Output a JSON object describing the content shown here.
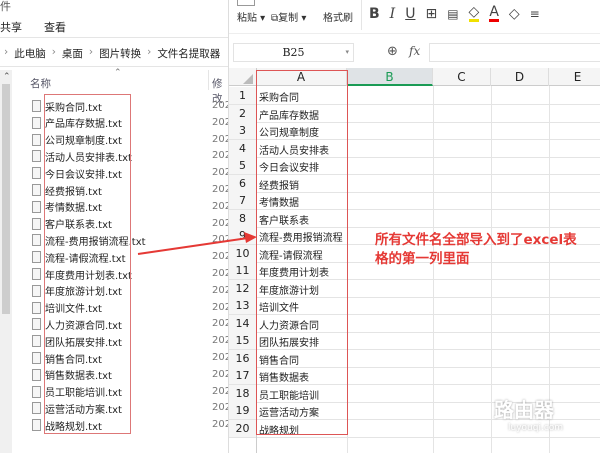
{
  "explorer": {
    "title_char": "件",
    "ribbon": [
      "共享",
      "查看"
    ],
    "breadcrumb": [
      "此电脑",
      "桌面",
      "图片转换",
      "文件名提取器"
    ],
    "col_name": "名称",
    "col_date": "修改",
    "date_prefix": "202",
    "files": [
      "采购合同.txt",
      "产品库存数据.txt",
      "公司规章制度.txt",
      "活动人员安排表.txt",
      "今日会议安排.txt",
      "经费报销.txt",
      "考情数据.txt",
      "客户联系表.txt",
      "流程-费用报销流程.txt",
      "流程-请假流程.txt",
      "年度费用计划表.txt",
      "年度旅游计划.txt",
      "培训文件.txt",
      "人力资源合同.txt",
      "团队拓展安排.txt",
      "销售合同.txt",
      "销售数据表.txt",
      "员工职能培训.txt",
      "运营活动方案.txt",
      "战略规划.txt"
    ]
  },
  "excel": {
    "toolbar": {
      "paste": "粘贴",
      "copy": "复制",
      "format_painter": "格式刷",
      "bold": "B",
      "italic": "I",
      "underline": "U"
    },
    "name_box": "B25",
    "fx": "fx",
    "columns": [
      "A",
      "B",
      "C",
      "D",
      "E"
    ],
    "rows": [
      "1",
      "2",
      "3",
      "4",
      "5",
      "6",
      "7",
      "8",
      "9",
      "10",
      "11",
      "12",
      "13",
      "14",
      "15",
      "16",
      "17",
      "18",
      "19",
      "20"
    ],
    "cells": [
      "采购合同",
      "产品库存数据",
      "公司规章制度",
      "活动人员安排表",
      "今日会议安排",
      "经费报销",
      "考情数据",
      "客户联系表",
      "流程-费用报销流程",
      "流程-请假流程",
      "年度费用计划表",
      "年度旅游计划",
      "培训文件",
      "人力资源合同",
      "团队拓展安排",
      "销售合同",
      "销售数据表",
      "员工职能培训",
      "运营活动方案",
      "战略规划"
    ]
  },
  "annotation": {
    "line1": "所有文件名全部导入到了excel表",
    "line2": "格的第一列里面",
    "color": "#e53935"
  },
  "watermark": {
    "text": "路由器",
    "sub": "luyouqi.com"
  }
}
